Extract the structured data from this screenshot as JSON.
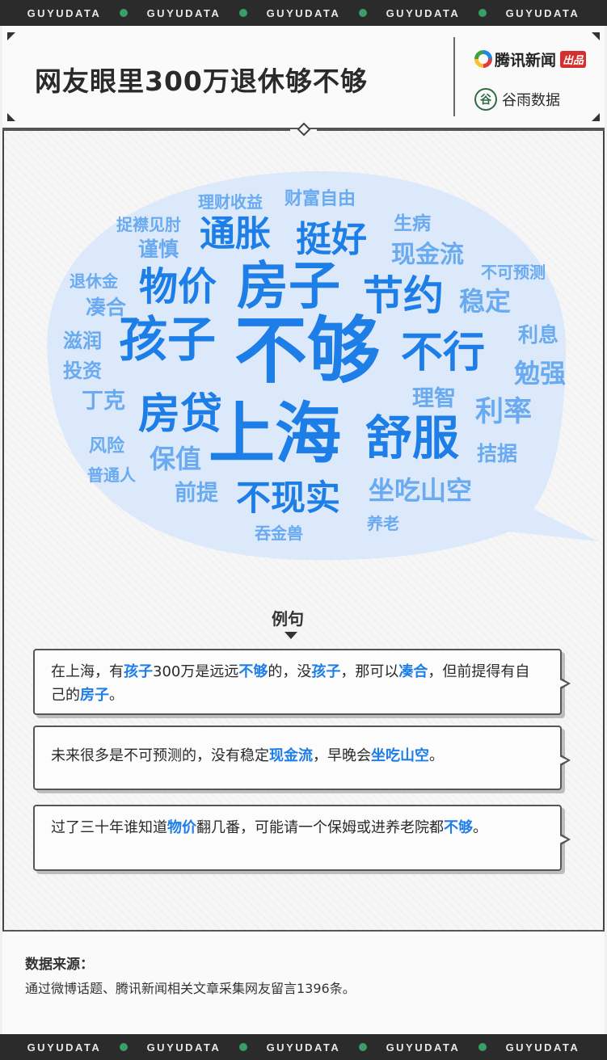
{
  "ribbon": {
    "text": "GUYUDATA",
    "repeat": 5
  },
  "header": {
    "title": "网友眼里300万退休够不够",
    "brand_primary": "腾讯新闻",
    "brand_badge": "出品",
    "brand_secondary": "谷雨数据",
    "brand_secondary_seal": "谷"
  },
  "word_cloud": {
    "colors": {
      "dark": "#1e7ee8",
      "light": "#6aaaf0",
      "bubble": "#dbe9fa"
    },
    "words": [
      {
        "text": "理财收益",
        "tone": "light"
      },
      {
        "text": "财富自由",
        "tone": "light"
      },
      {
        "text": "捉襟见肘",
        "tone": "light"
      },
      {
        "text": "生病",
        "tone": "light"
      },
      {
        "text": "谨慎",
        "tone": "light"
      },
      {
        "text": "通胀",
        "tone": "dark"
      },
      {
        "text": "挺好",
        "tone": "dark"
      },
      {
        "text": "现金流",
        "tone": "light"
      },
      {
        "text": "不可预测",
        "tone": "light"
      },
      {
        "text": "退休金",
        "tone": "light"
      },
      {
        "text": "物价",
        "tone": "dark"
      },
      {
        "text": "房子",
        "tone": "dark"
      },
      {
        "text": "节约",
        "tone": "dark"
      },
      {
        "text": "稳定",
        "tone": "light"
      },
      {
        "text": "凑合",
        "tone": "light"
      },
      {
        "text": "滋润",
        "tone": "light"
      },
      {
        "text": "孩子",
        "tone": "dark"
      },
      {
        "text": "不够",
        "tone": "dark"
      },
      {
        "text": "不行",
        "tone": "dark"
      },
      {
        "text": "利息",
        "tone": "light"
      },
      {
        "text": "投资",
        "tone": "light"
      },
      {
        "text": "勉强",
        "tone": "light"
      },
      {
        "text": "丁克",
        "tone": "light"
      },
      {
        "text": "理智",
        "tone": "light"
      },
      {
        "text": "房贷",
        "tone": "dark"
      },
      {
        "text": "利率",
        "tone": "light"
      },
      {
        "text": "上海",
        "tone": "dark"
      },
      {
        "text": "舒服",
        "tone": "dark"
      },
      {
        "text": "风险",
        "tone": "light"
      },
      {
        "text": "保值",
        "tone": "light"
      },
      {
        "text": "拮据",
        "tone": "light"
      },
      {
        "text": "普通人",
        "tone": "light"
      },
      {
        "text": "前提",
        "tone": "light"
      },
      {
        "text": "不现实",
        "tone": "dark"
      },
      {
        "text": "坐吃山空",
        "tone": "light"
      },
      {
        "text": "吞金兽",
        "tone": "light"
      },
      {
        "text": "养老",
        "tone": "light"
      }
    ]
  },
  "examples": {
    "title": "例句",
    "items": [
      [
        {
          "t": "在上海，有"
        },
        {
          "t": "孩子",
          "hl": true
        },
        {
          "t": "300万是远远"
        },
        {
          "t": "不够",
          "hl": true
        },
        {
          "t": "的，没"
        },
        {
          "t": "孩子",
          "hl": true
        },
        {
          "t": "，那可以"
        },
        {
          "t": "凑合",
          "hl": true
        },
        {
          "t": "，但前提得有自己的"
        },
        {
          "t": "房子",
          "hl": true
        },
        {
          "t": "。"
        }
      ],
      [
        {
          "t": "未来很多是不可预测的，没有稳定"
        },
        {
          "t": "现金流",
          "hl": true
        },
        {
          "t": "，早晚会"
        },
        {
          "t": "坐吃山空",
          "hl": true
        },
        {
          "t": "。"
        }
      ],
      [
        {
          "t": "过了三十年谁知道"
        },
        {
          "t": "物价",
          "hl": true
        },
        {
          "t": "翻几番，可能请一个保姆或进养老院都"
        },
        {
          "t": "不够",
          "hl": true
        },
        {
          "t": "。"
        }
      ]
    ]
  },
  "source": {
    "label": "数据来源：",
    "text": "通过微博话题、腾讯新闻相关文章采集网友留言1396条。"
  }
}
